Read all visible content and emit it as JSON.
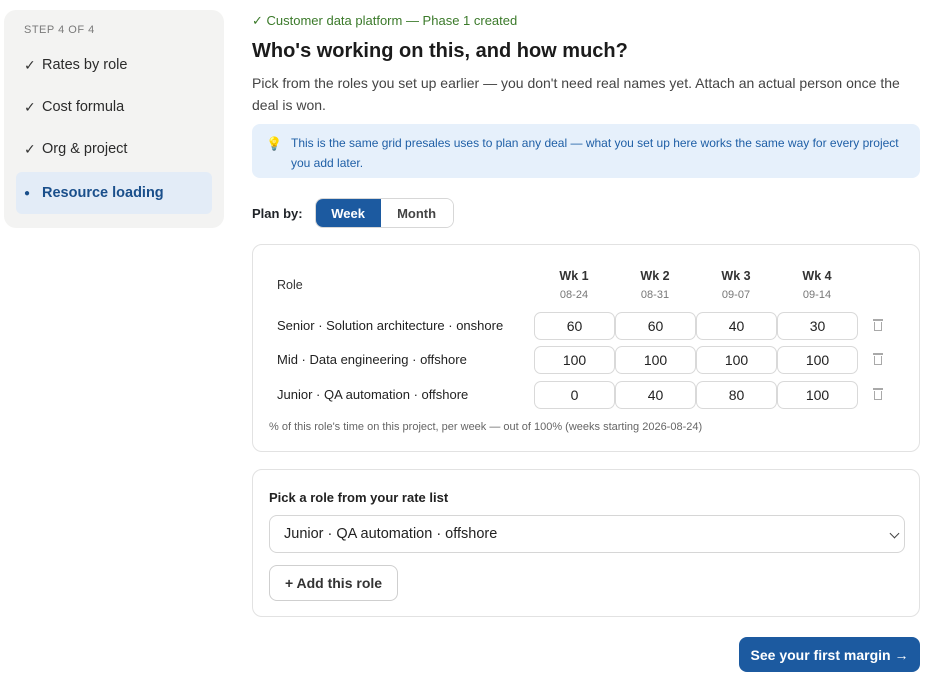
{
  "sidebar": {
    "step_label": "STEP 4 OF 4",
    "steps": [
      {
        "label": "Rates by role",
        "mark": "✓"
      },
      {
        "label": "Cost formula",
        "mark": "✓"
      },
      {
        "label": "Org & project",
        "mark": "✓"
      },
      {
        "label": "Resource loading",
        "mark": "●"
      }
    ]
  },
  "main": {
    "created_notice": "✓ Customer data platform — Phase 1 created",
    "title": "Who's working on this, and how much?",
    "intro": "Pick from the roles you set up earlier — you don't need real names yet. Attach an actual person once the deal is won.",
    "tip": {
      "icon": "lightbulb-icon",
      "text": "This is the same grid presales uses to plan any deal — what you set up here works the same way for every project you add later."
    },
    "plan_by": {
      "label": "Plan by:",
      "options": [
        "Week",
        "Month"
      ],
      "selected": "Week"
    },
    "grid": {
      "role_header": "Role",
      "weeks": [
        {
          "label": "Wk 1",
          "date": "08-24"
        },
        {
          "label": "Wk 2",
          "date": "08-31"
        },
        {
          "label": "Wk 3",
          "date": "09-07"
        },
        {
          "label": "Wk 4",
          "date": "09-14"
        }
      ],
      "rows": [
        {
          "role": "Senior · Solution architecture · onshore",
          "values": [
            "60",
            "60",
            "40",
            "30"
          ]
        },
        {
          "role": "Mid · Data engineering · offshore",
          "values": [
            "100",
            "100",
            "100",
            "100"
          ]
        },
        {
          "role": "Junior · QA automation · offshore",
          "values": [
            "0",
            "40",
            "80",
            "100"
          ]
        }
      ],
      "note": "% of this role's time on this project, per week — out of 100% (weeks starting 2026-08-24)"
    },
    "picker": {
      "label": "Pick a role from your rate list",
      "selected_role": "Junior · QA automation · offshore",
      "add_button": "+ Add this role"
    },
    "cta": "See your first margin →"
  },
  "colors": {
    "accent": "#1c5aa0",
    "success": "#3b7a2a",
    "tip_bg": "#e6f0fb"
  }
}
